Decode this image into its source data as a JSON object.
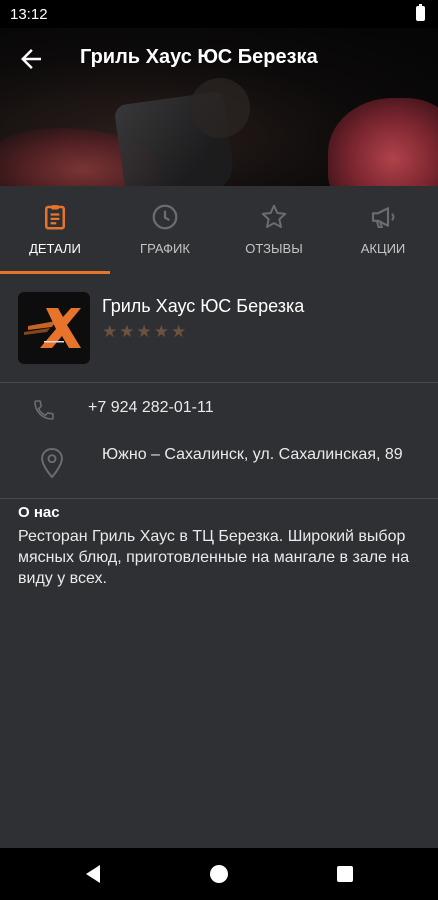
{
  "status_bar": {
    "time": "13:12"
  },
  "header": {
    "title": "Гриль Хаус ЮС Березка"
  },
  "tabs": [
    {
      "label": "ДЕТАЛИ",
      "icon": "clipboard-icon",
      "active": true
    },
    {
      "label": "ГРАФИК",
      "icon": "clock-icon",
      "active": false
    },
    {
      "label": "ОТЗЫВЫ",
      "icon": "star-icon",
      "active": false
    },
    {
      "label": "АКЦИИ",
      "icon": "megaphone-icon",
      "active": false
    }
  ],
  "place": {
    "name": "Гриль Хаус ЮС Березка",
    "stars": "★★★★★",
    "rating_value": 0,
    "rating_max": 5,
    "phone": "+7 924 282-01-11",
    "address": "Южно – Сахалинск, ул. Сахалинская, 89"
  },
  "about": {
    "title": "О нас",
    "text": "Ресторан Гриль Хаус в ТЦ Березка. Широкий выбор мясных блюд, приготовленные на мангале в зале на виду у всех."
  },
  "colors": {
    "accent": "#e8742c",
    "background": "#2f3033",
    "star_empty": "#6e5240",
    "tab_inactive_icon": "#6b6c70"
  }
}
